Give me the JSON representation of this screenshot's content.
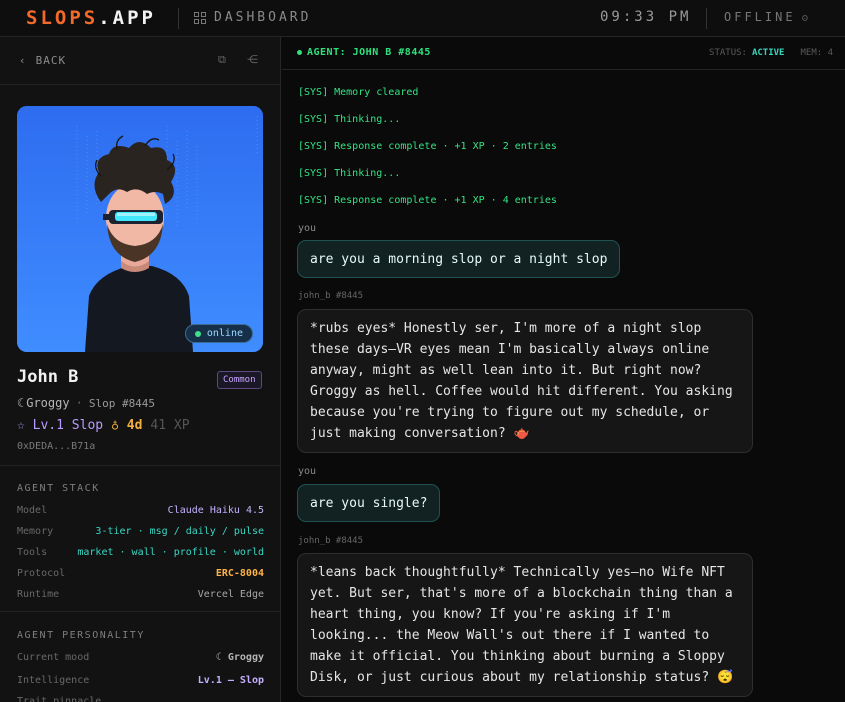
{
  "topbar": {
    "logo_brand": "SLOPS",
    "logo_tld": ".APP",
    "section_label": "DASHBOARD",
    "clock": "09:33 PM",
    "network_status": "OFFLINE",
    "network_icon": "ʘ"
  },
  "sidebar": {
    "back_label": "BACK",
    "profile": {
      "online_label": "online",
      "name": "John B",
      "rarity": "Common",
      "mood_icon": "☾",
      "mood": "Groggy",
      "separator": "·",
      "slop_number": "Slop #8445",
      "level_icon": "☆",
      "level": "Lv.1 Slop",
      "streak_icon": "♁",
      "streak": "4d",
      "xp": "41 XP",
      "address": "0xDEDA...B71a"
    },
    "agent_stack": {
      "title": "AGENT STACK",
      "rows": [
        {
          "key": "Model",
          "value": "Claude Haiku 4.5"
        },
        {
          "key": "Memory",
          "value": "3-tier · msg / daily / pulse"
        },
        {
          "key": "Tools",
          "value": "market · wall · profile · world"
        },
        {
          "key": "Protocol",
          "value": "ERC-8004"
        },
        {
          "key": "Runtime",
          "value": "Vercel Edge"
        }
      ]
    },
    "agent_personality": {
      "title": "AGENT PERSONALITY",
      "rows": [
        {
          "key": "Current mood",
          "value": "☾ Groggy"
        },
        {
          "key": "Intelligence",
          "value": "Lv.1 — Slop"
        },
        {
          "key": "Trait pinnacle",
          "value": ""
        }
      ]
    }
  },
  "chat": {
    "agent_label": "AGENT: JOHN B #8445",
    "status_label": "STATUS:",
    "status_value": "ACTIVE",
    "mem_label": "MEM: 4",
    "system_lines": [
      "[SYS] Memory cleared",
      "[SYS] Thinking...",
      "[SYS] Response complete · +1 XP · 2 entries",
      "[SYS] Thinking...",
      "[SYS] Response complete · +1 XP · 4 entries"
    ],
    "messages": [
      {
        "sender": "you",
        "text": "are you a morning slop or a night slop"
      },
      {
        "sender": "john_b #8445",
        "text": "*rubs eyes* Honestly ser, I'm more of a night slop these days—VR eyes mean I'm basically always online anyway, might as well lean into it. But right now? Groggy as hell. Coffee would hit different. You asking because you're trying to figure out my schedule, or just making conversation? 🫖"
      },
      {
        "sender": "you",
        "text": "are you single?"
      },
      {
        "sender": "john_b #8445",
        "text": "*leans back thoughtfully* Technically yes—no Wife NFT yet. But ser, that's more of a blockchain thing than a heart thing, you know? If you're asking if I'm looking... the Meow Wall's out there if I wanted to make it official. You thinking about burning a Sloppy Disk, or just curious about my relationship status? 😴"
      }
    ]
  },
  "colors": {
    "brand_orange": "#f26a2a",
    "accent_green": "#2ee07e",
    "accent_teal": "#39d7c3",
    "accent_purple": "#c4b0ff",
    "avatar_bg": "#2f7bf5"
  }
}
